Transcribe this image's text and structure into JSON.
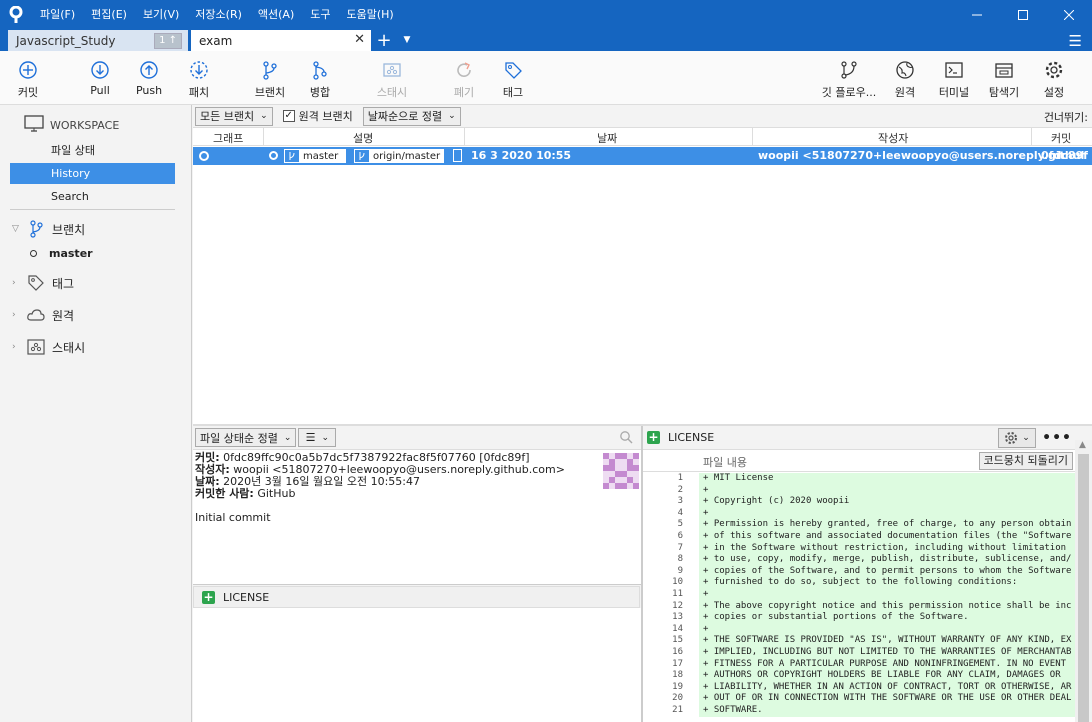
{
  "menu": [
    "파일(F)",
    "편집(E)",
    "보기(V)",
    "저장소(R)",
    "액션(A)",
    "도구",
    "도움말(H)"
  ],
  "tabs": [
    {
      "label": "Javascript_Study",
      "badge": "1 ↑"
    },
    {
      "label": "exam"
    }
  ],
  "toolbar": {
    "commit": "커밋",
    "pull": "Pull",
    "push": "Push",
    "fetch": "패치",
    "branch": "브랜치",
    "merge": "병합",
    "stash": "스태시",
    "discard": "폐기",
    "tag": "태그",
    "gitflow": "깃 플로우...",
    "remote": "원격",
    "terminal": "터미널",
    "explorer": "탐색기",
    "settings": "설정"
  },
  "sidebar": {
    "workspace": "WORKSPACE",
    "items": [
      "파일 상태",
      "History",
      "Search"
    ],
    "branches": "브랜치",
    "branch_current": "master",
    "tags": "태그",
    "remotes": "원격",
    "stashes": "스태시"
  },
  "filter": {
    "branches_dd": "모든 브랜치",
    "remote_chk": "원격 브랜치",
    "sort_dd": "날짜순으로 정렬",
    "jump": "건너뛰기:"
  },
  "columns": {
    "graph": "그래프",
    "desc": "설명",
    "date": "날짜",
    "author": "작성자",
    "commit": "커밋"
  },
  "commit": {
    "ref1": "master",
    "ref2": "origin/master",
    "date": "16 3 2020 10:55",
    "author": "woopii <51807270+leewoopyo@users.noreply.githul",
    "hash": "0fdc89f"
  },
  "details": {
    "sort_dd": "파일 상태순 정렬",
    "k_commit": "커밋:",
    "v_commit": " 0fdc89ffc90c0a5b7dc5f7387922fac8f5f07760 [0fdc89f]",
    "k_author": "작성자:",
    "v_author": " woopii <51807270+leewoopyo@users.noreply.github.com>",
    "k_date": "날짜:",
    "v_date": " 2020년 3월 16일 월요일 오전 10:55:47",
    "k_committer": "커밋한 사람:",
    "v_committer": " GitHub",
    "message": "Initial commit",
    "file": "LICENSE"
  },
  "diff": {
    "file": "LICENSE",
    "sub_label": "파일 내용",
    "revert": "코드뭉치 되돌리기",
    "lines": [
      "+ MIT License",
      "+",
      "+ Copyright (c) 2020 woopii",
      "+",
      "+ Permission is hereby granted, free of charge, to any person obtain",
      "+ of this software and associated documentation files (the \"Software",
      "+ in the Software without restriction, including without limitation",
      "+ to use, copy, modify, merge, publish, distribute, sublicense, and/",
      "+ copies of the Software, and to permit persons to whom the Software",
      "+ furnished to do so, subject to the following conditions:",
      "+",
      "+ The above copyright notice and this permission notice shall be inc",
      "+ copies or substantial portions of the Software.",
      "+",
      "+ THE SOFTWARE IS PROVIDED \"AS IS\", WITHOUT WARRANTY OF ANY KIND, EX",
      "+ IMPLIED, INCLUDING BUT NOT LIMITED TO THE WARRANTIES OF MERCHANTAB",
      "+ FITNESS FOR A PARTICULAR PURPOSE AND NONINFRINGEMENT. IN NO EVENT",
      "+ AUTHORS OR COPYRIGHT HOLDERS BE LIABLE FOR ANY CLAIM, DAMAGES OR",
      "+ LIABILITY, WHETHER IN AN ACTION OF CONTRACT, TORT OR OTHERWISE, AR",
      "+ OUT OF OR IN CONNECTION WITH THE SOFTWARE OR THE USE OR OTHER DEAL",
      "+ SOFTWARE."
    ]
  }
}
